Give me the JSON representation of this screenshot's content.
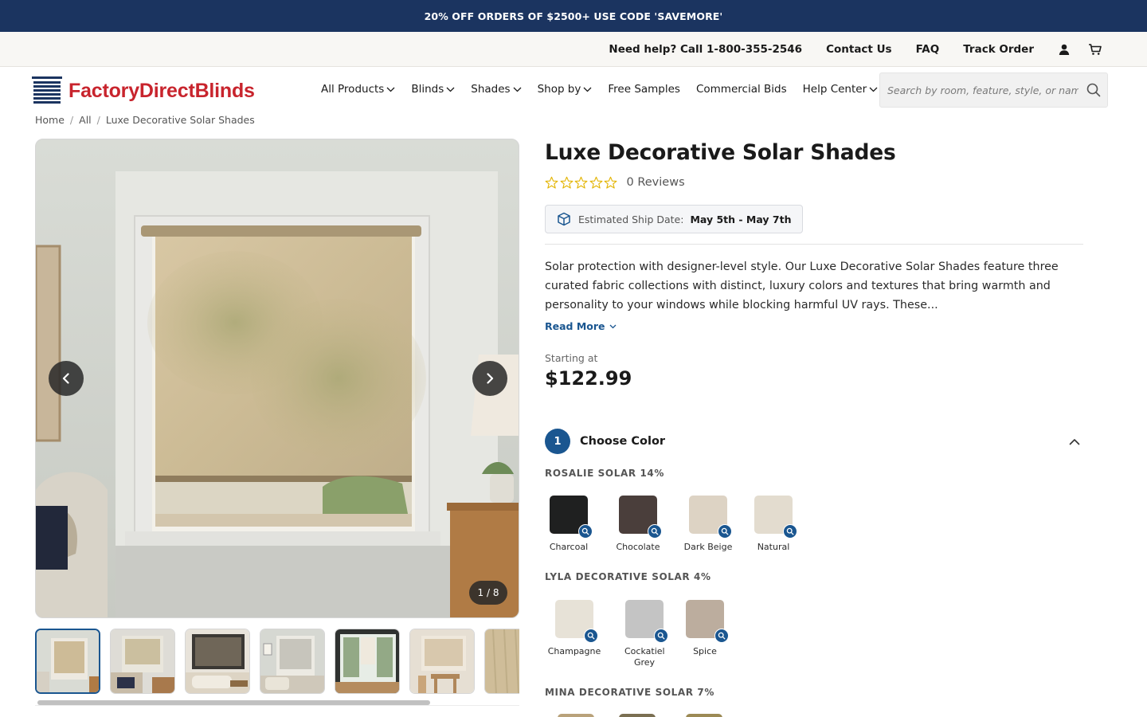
{
  "promo": {
    "text": "20% OFF ORDERS OF $2500+ USE CODE 'SAVEMORE'"
  },
  "utility": {
    "help": "Need help? Call 1-800-355-2546",
    "contact": "Contact Us",
    "faq": "FAQ",
    "track": "Track Order",
    "icons": [
      "account-icon",
      "cart-icon"
    ]
  },
  "logo": {
    "text": "FactoryDirectBlinds"
  },
  "nav": {
    "items": [
      {
        "label": "All Products",
        "dropdown": true
      },
      {
        "label": "Blinds",
        "dropdown": true
      },
      {
        "label": "Shades",
        "dropdown": true
      },
      {
        "label": "Shop by",
        "dropdown": true
      },
      {
        "label": "Free Samples",
        "dropdown": false
      },
      {
        "label": "Commercial Bids",
        "dropdown": false
      },
      {
        "label": "Help Center",
        "dropdown": true
      }
    ]
  },
  "search": {
    "placeholder": "Search by room, feature, style, or name"
  },
  "breadcrumb": [
    "Home",
    "All",
    "Luxe Decorative Solar Shades"
  ],
  "gallery": {
    "counter": "1 / 8",
    "thumbnail_count": 7,
    "active_index": 0
  },
  "product": {
    "title": "Luxe Decorative Solar Shades",
    "rating": 0,
    "reviews": "0 Reviews",
    "ship_label": "Estimated Ship Date:",
    "ship_date": "May 5th - May 7th",
    "description": "Solar protection with designer-level style. Our Luxe Decorative Solar Shades feature three curated fabric collections with distinct, luxury colors and textures that bring warmth and personality to your windows while blocking harmful UV rays. These...",
    "read_more": "Read More",
    "starting_at": "Starting at",
    "price": "$122.99"
  },
  "step": {
    "number": "1",
    "label": "Choose Color"
  },
  "collections": [
    {
      "name": "ROSALIE SOLAR 14%",
      "swatches": [
        {
          "name": "Charcoal",
          "color": "#1f2020"
        },
        {
          "name": "Chocolate",
          "color": "#4a3e3b"
        },
        {
          "name": "Dark Beige",
          "color": "#ddd3c4"
        },
        {
          "name": "Natural",
          "color": "#e3dccf"
        }
      ]
    },
    {
      "name": "LYLA DECORATIVE SOLAR 4%",
      "swatches": [
        {
          "name": "Champagne",
          "color": "#e7e2d7"
        },
        {
          "name": "Cockatiel Grey",
          "color": "#c4c4c4"
        },
        {
          "name": "Spice",
          "color": "#bcad9e"
        }
      ]
    },
    {
      "name": "MINA DECORATIVE SOLAR 7%",
      "swatches": []
    }
  ],
  "colors": {
    "brand_navy": "#1b3460",
    "accent_blue": "#1a5690",
    "logo_red": "#c8242d",
    "star_gold": "#e3b400"
  }
}
